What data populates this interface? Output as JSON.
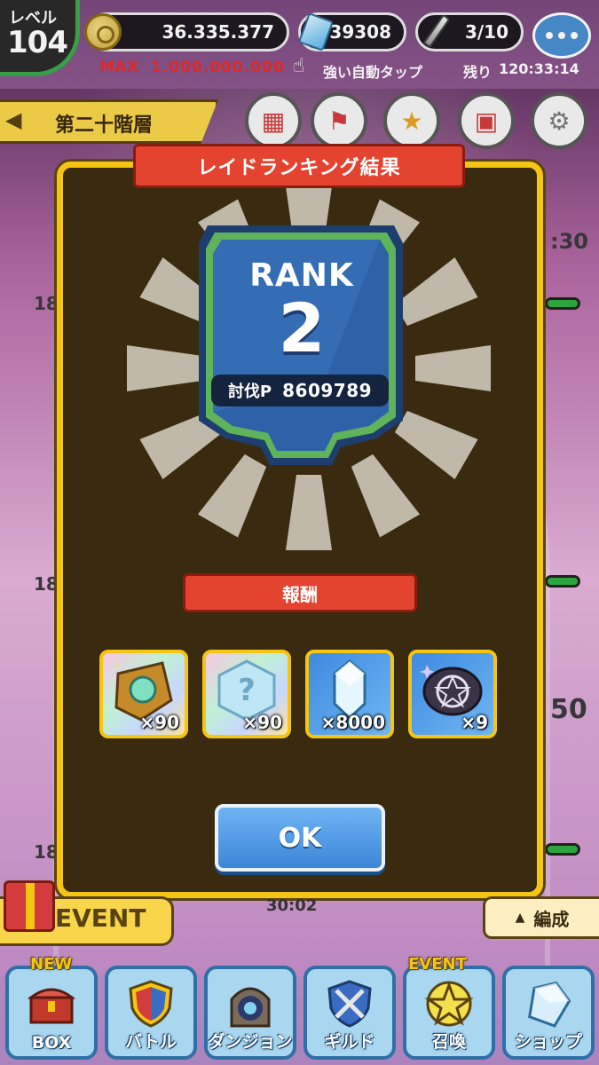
{
  "hud": {
    "level_label": "レベル",
    "level_value": "104",
    "gold_value": "36.335.377",
    "gem_value": "39308",
    "stamina_value": "3/10",
    "max_prefix": "MAX",
    "max_value": "1.000.000.000",
    "auto_tap_label": "強い自動タップ",
    "remain_label": "残り",
    "remain_time": "120:33:14"
  },
  "floor": {
    "label": "第二十階層"
  },
  "modal": {
    "title": "レイドランキング結果",
    "rank_label": "RANK",
    "rank_value": "2",
    "points_label": "討伐P",
    "points_value": "8609789",
    "reward_title": "報酬",
    "rewards": [
      {
        "icon": "rainbow-scroll-icon",
        "qty": "×90"
      },
      {
        "icon": "mystery-gem-icon",
        "qty": "×90"
      },
      {
        "icon": "crystal-icon",
        "qty": "×8000"
      },
      {
        "icon": "pentagram-stone-icon",
        "qty": "×9"
      }
    ],
    "ok_label": "OK"
  },
  "lower": {
    "event_label": "EVENT",
    "timer": "30:02",
    "formation_arrow": "▲",
    "formation_label": "編成"
  },
  "background_numbers": [
    "18",
    "18",
    "18",
    "18",
    "50",
    ":30"
  ],
  "nav": [
    {
      "label": "BOX",
      "tag": "NEW",
      "icon": "treasure-chest-icon"
    },
    {
      "label": "バトル",
      "tag": "",
      "icon": "shield-icon"
    },
    {
      "label": "ダンジョン",
      "tag": "",
      "icon": "portal-icon"
    },
    {
      "label": "ギルド",
      "tag": "",
      "icon": "crossed-swords-icon"
    },
    {
      "label": "召喚",
      "tag": "EVENT",
      "icon": "pentagram-icon"
    },
    {
      "label": "ショップ",
      "tag": "",
      "icon": "gem-shop-icon"
    }
  ],
  "colors": {
    "modal_bg": "#3a2b10",
    "modal_border": "#f4c514",
    "banner_red": "#e4432f",
    "shield_blue": "#2d62a8",
    "shield_green": "#5fb35a",
    "ok_blue": "#3b86d6"
  }
}
